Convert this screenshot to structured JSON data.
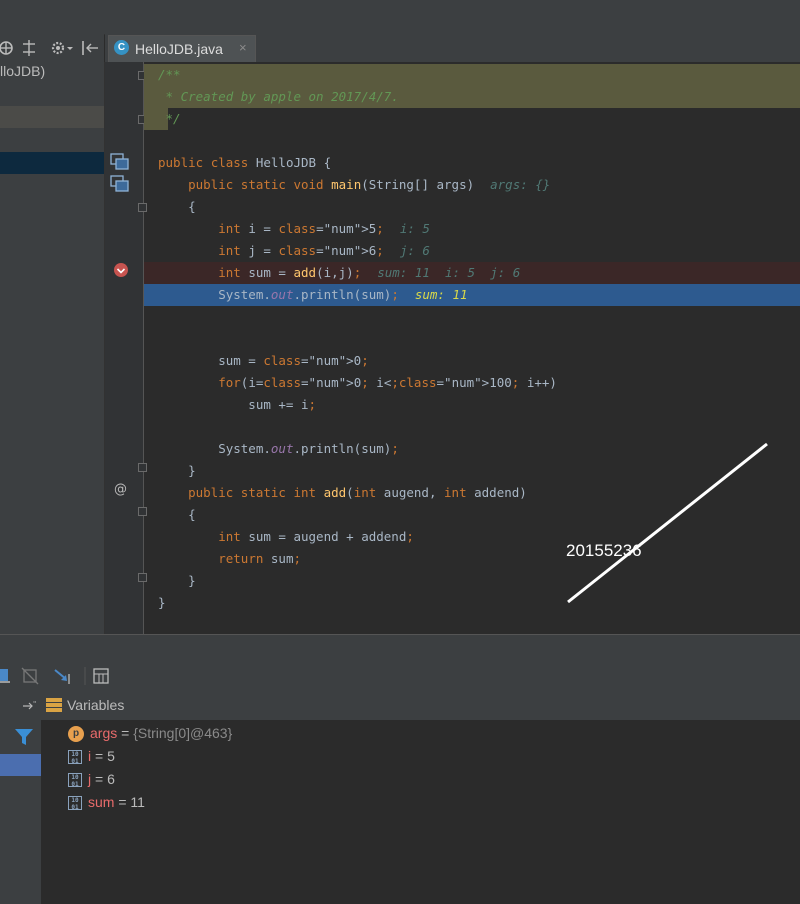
{
  "editor": {
    "tab_name": "HelloJDB.java",
    "tab_icon_letter": "C",
    "tab_close": "×"
  },
  "project": {
    "label": "lloJDB)"
  },
  "code": {
    "lines": [
      {
        "t": "/**"
      },
      {
        "t": " * Created by apple on 2017/4/7."
      },
      {
        "t": " */"
      },
      {
        "t": ""
      },
      {
        "t": "public class HelloJDB {"
      },
      {
        "t": "    public static void main(String[] args)"
      },
      {
        "t": "    {"
      },
      {
        "t": "        int i = 5;"
      },
      {
        "t": "        int j = 6;"
      },
      {
        "t": "        int sum = add(i,j);"
      },
      {
        "t": "        System.out.println(sum);"
      },
      {
        "t": ""
      },
      {
        "t": ""
      },
      {
        "t": "        sum = 0;"
      },
      {
        "t": "        for(i=0; i<100; i++)"
      },
      {
        "t": "            sum += i;"
      },
      {
        "t": ""
      },
      {
        "t": "        System.out.println(sum);"
      },
      {
        "t": "    }"
      },
      {
        "t": "    public static int add(int augend, int addend)"
      },
      {
        "t": "    {"
      },
      {
        "t": "        int sum = augend + addend;"
      },
      {
        "t": "        return sum;"
      },
      {
        "t": "    }"
      },
      {
        "t": "}"
      }
    ],
    "inline_values": {
      "main_args": "args: {}",
      "i": "i: 5",
      "j": "j: 6",
      "sum_line": "sum: 11  i: 5  j: 6",
      "println": "sum: 11"
    }
  },
  "debugger": {
    "variables_title": "Variables",
    "variables": [
      {
        "name": "args",
        "eq": " = ",
        "value": "{String[0]@463}",
        "icon": "p"
      },
      {
        "name": "i",
        "eq": " = ",
        "value": "5",
        "icon": "binary"
      },
      {
        "name": "j",
        "eq": " = ",
        "value": "6",
        "icon": "binary"
      },
      {
        "name": "sum",
        "eq": " = ",
        "value": "11",
        "icon": "binary"
      }
    ],
    "binary_glyph_top": "10",
    "binary_glyph_bottom": "01"
  },
  "watermark": "20155236",
  "colors": {
    "keyword": "#cc7832",
    "number": "#6897bb",
    "comment": "#629755",
    "exec_line": "#2d5a8f",
    "breakpoint": "#c75450"
  }
}
